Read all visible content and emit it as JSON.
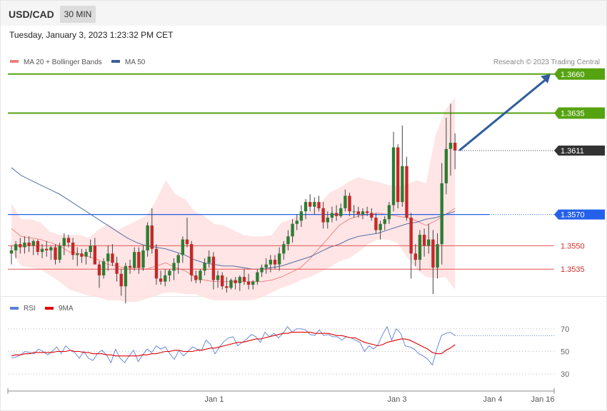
{
  "header": {
    "symbol": "USD/CAD",
    "timeframe": "30 MIN"
  },
  "datetime": "Tuesday, January 3, 2023 1:23:32 PM CET",
  "legend": {
    "ma20": "MA 20 + Bollinger Bands",
    "ma50": "MA 50",
    "credit": "Research © 2023 Trading Central",
    "rsi": "RSI",
    "rsi9": "9MA"
  },
  "colors": {
    "up": "#2e7d32",
    "down": "#c62828",
    "band": "#ffdcdc",
    "ma20": "#f08080",
    "ma50": "#3f5f9f",
    "resistance": "#56a311",
    "last": "#333333",
    "pivot": "#2461ea",
    "support": "#e05555",
    "arrow": "#2f5d9e",
    "rsi": "#5b7fd8",
    "rsi9": "#e00000"
  },
  "chart_data": [
    {
      "type": "candlestick",
      "ylim": [
        1.352,
        1.368
      ],
      "x_ticks": [
        "Jan 1",
        "Jan 3",
        "Jan 4",
        "Jan 16"
      ],
      "levels": [
        {
          "value": 1.366,
          "label": "1.3660",
          "kind": "resistance"
        },
        {
          "value": 1.3635,
          "label": "1.3635",
          "kind": "resistance"
        },
        {
          "value": 1.3611,
          "label": "1.3611",
          "kind": "last"
        },
        {
          "value": 1.357,
          "label": "1.3570",
          "kind": "pivot"
        },
        {
          "value": 1.355,
          "label": "1.3550",
          "kind": "support"
        },
        {
          "value": 1.3535,
          "label": "1.3535",
          "kind": "support"
        }
      ],
      "ohlc": [
        [
          1.3545,
          1.355,
          1.3538,
          1.3547
        ],
        [
          1.3547,
          1.3553,
          1.3542,
          1.3551
        ],
        [
          1.3551,
          1.3555,
          1.3545,
          1.3549
        ],
        [
          1.3549,
          1.3556,
          1.3545,
          1.3552
        ],
        [
          1.3552,
          1.3556,
          1.3546,
          1.355
        ],
        [
          1.355,
          1.3554,
          1.3544,
          1.3553
        ],
        [
          1.3553,
          1.3554,
          1.3544,
          1.3546
        ],
        [
          1.3546,
          1.3551,
          1.3542,
          1.3548
        ],
        [
          1.3548,
          1.3553,
          1.3543,
          1.3547
        ],
        [
          1.3547,
          1.355,
          1.3541,
          1.3549
        ],
        [
          1.3549,
          1.3551,
          1.3538,
          1.3541
        ],
        [
          1.3541,
          1.3552,
          1.3539,
          1.355
        ],
        [
          1.355,
          1.3558,
          1.3544,
          1.3555
        ],
        [
          1.3555,
          1.3557,
          1.3549,
          1.3552
        ],
        [
          1.3552,
          1.3555,
          1.3541,
          1.3544
        ],
        [
          1.3544,
          1.3549,
          1.3537,
          1.3545
        ],
        [
          1.3545,
          1.3548,
          1.3539,
          1.3543
        ],
        [
          1.3543,
          1.3548,
          1.3538,
          1.3546
        ],
        [
          1.3546,
          1.3554,
          1.3542,
          1.355
        ],
        [
          1.355,
          1.3555,
          1.354,
          1.3538
        ],
        [
          1.3538,
          1.354,
          1.3523,
          1.3531
        ],
        [
          1.3531,
          1.3542,
          1.3529,
          1.354
        ],
        [
          1.354,
          1.355,
          1.3534,
          1.3545
        ],
        [
          1.3545,
          1.3551,
          1.3537,
          1.3539
        ],
        [
          1.3539,
          1.3543,
          1.3527,
          1.3532
        ],
        [
          1.3532,
          1.3535,
          1.3518,
          1.3524
        ],
        [
          1.3524,
          1.3539,
          1.3513,
          1.3537
        ],
        [
          1.3537,
          1.3541,
          1.3532,
          1.3536
        ],
        [
          1.3536,
          1.3549,
          1.3534,
          1.3546
        ],
        [
          1.3546,
          1.3549,
          1.3532,
          1.3536
        ],
        [
          1.3536,
          1.355,
          1.3534,
          1.3547
        ],
        [
          1.3547,
          1.3565,
          1.3543,
          1.3563
        ],
        [
          1.3563,
          1.3574,
          1.3545,
          1.3548
        ],
        [
          1.3548,
          1.3551,
          1.3525,
          1.3529
        ],
        [
          1.3529,
          1.3534,
          1.3525,
          1.3527
        ],
        [
          1.3527,
          1.3535,
          1.3524,
          1.3531
        ],
        [
          1.3531,
          1.3535,
          1.3527,
          1.3534
        ],
        [
          1.3534,
          1.3542,
          1.3528,
          1.3539
        ],
        [
          1.3539,
          1.3545,
          1.3532,
          1.3544
        ],
        [
          1.3544,
          1.3556,
          1.3539,
          1.3554
        ],
        [
          1.3554,
          1.3568,
          1.3549,
          1.3551
        ],
        [
          1.3551,
          1.3553,
          1.3527,
          1.3531
        ],
        [
          1.3531,
          1.3534,
          1.3526,
          1.3528
        ],
        [
          1.3528,
          1.3535,
          1.3526,
          1.3534
        ],
        [
          1.3534,
          1.3542,
          1.3531,
          1.3539
        ],
        [
          1.3539,
          1.3547,
          1.3536,
          1.3543
        ],
        [
          1.3543,
          1.3546,
          1.3522,
          1.3528
        ],
        [
          1.3528,
          1.3534,
          1.3523,
          1.3531
        ],
        [
          1.3531,
          1.3533,
          1.3522,
          1.3524
        ],
        [
          1.3524,
          1.353,
          1.352,
          1.3523
        ],
        [
          1.3523,
          1.3529,
          1.3522,
          1.3528
        ],
        [
          1.3528,
          1.353,
          1.3522,
          1.3526
        ],
        [
          1.3526,
          1.3531,
          1.3521,
          1.353
        ],
        [
          1.353,
          1.3535,
          1.3525,
          1.3527
        ],
        [
          1.3527,
          1.3532,
          1.3522,
          1.3525
        ],
        [
          1.3525,
          1.3528,
          1.3522,
          1.3527
        ],
        [
          1.3527,
          1.3535,
          1.3525,
          1.3533
        ],
        [
          1.3533,
          1.3538,
          1.353,
          1.3536
        ],
        [
          1.3536,
          1.3542,
          1.3532,
          1.3538
        ],
        [
          1.3538,
          1.3544,
          1.3533,
          1.3541
        ],
        [
          1.3541,
          1.3544,
          1.3535,
          1.3538
        ],
        [
          1.3538,
          1.3549,
          1.3534,
          1.3545
        ],
        [
          1.3545,
          1.3553,
          1.3541,
          1.3551
        ],
        [
          1.3551,
          1.356,
          1.3547,
          1.3556
        ],
        [
          1.3556,
          1.3567,
          1.3552,
          1.3564
        ],
        [
          1.3564,
          1.357,
          1.356,
          1.3566
        ],
        [
          1.3566,
          1.3576,
          1.3562,
          1.3572
        ],
        [
          1.3572,
          1.358,
          1.3567,
          1.3578
        ],
        [
          1.3578,
          1.3583,
          1.3572,
          1.3575
        ],
        [
          1.3575,
          1.3581,
          1.357,
          1.3578
        ],
        [
          1.3578,
          1.3582,
          1.3572,
          1.3574
        ],
        [
          1.3574,
          1.3578,
          1.3561,
          1.3565
        ],
        [
          1.3565,
          1.3572,
          1.3561,
          1.3568
        ],
        [
          1.3568,
          1.3575,
          1.3565,
          1.3571
        ],
        [
          1.3571,
          1.3576,
          1.3566,
          1.3569
        ],
        [
          1.3569,
          1.3577,
          1.3568,
          1.3574
        ],
        [
          1.3574,
          1.3586,
          1.3572,
          1.3582
        ],
        [
          1.3582,
          1.3584,
          1.3569,
          1.3572
        ],
        [
          1.3572,
          1.3576,
          1.3568,
          1.3572
        ],
        [
          1.3572,
          1.3575,
          1.3568,
          1.357
        ],
        [
          1.357,
          1.3574,
          1.3567,
          1.3572
        ],
        [
          1.3572,
          1.3575,
          1.3569,
          1.3571
        ],
        [
          1.3571,
          1.3574,
          1.3566,
          1.3568
        ],
        [
          1.3568,
          1.3571,
          1.3558,
          1.356
        ],
        [
          1.356,
          1.3566,
          1.3554,
          1.3564
        ],
        [
          1.3564,
          1.3569,
          1.356,
          1.3567
        ],
        [
          1.3567,
          1.3578,
          1.3564,
          1.3576
        ],
        [
          1.3576,
          1.3623,
          1.3572,
          1.3613
        ],
        [
          1.3613,
          1.3615,
          1.3574,
          1.3578
        ],
        [
          1.3578,
          1.3627,
          1.3575,
          1.3601
        ],
        [
          1.3601,
          1.3607,
          1.3566,
          1.3568
        ],
        [
          1.3568,
          1.3571,
          1.3529,
          1.3545
        ],
        [
          1.3545,
          1.3551,
          1.3537,
          1.3541
        ],
        [
          1.3541,
          1.356,
          1.3534,
          1.3557
        ],
        [
          1.3557,
          1.3561,
          1.3543,
          1.355
        ],
        [
          1.355,
          1.3564,
          1.3545,
          1.3554
        ],
        [
          1.3554,
          1.356,
          1.3519,
          1.3536
        ],
        [
          1.3536,
          1.3558,
          1.3529,
          1.3551
        ],
        [
          1.3551,
          1.3603,
          1.3538,
          1.359
        ],
        [
          1.359,
          1.3632,
          1.3583,
          1.3612
        ],
        [
          1.3612,
          1.3641,
          1.3595,
          1.3616
        ],
        [
          1.3616,
          1.3622,
          1.3599,
          1.3611
        ]
      ],
      "bollinger": {
        "upper": [
          1.3577,
          1.3567,
          1.3567,
          1.3565,
          1.3559,
          1.3557,
          1.3557,
          1.3557,
          1.3555,
          1.356,
          1.3564,
          1.356,
          1.3563,
          1.3566,
          1.3569,
          1.3579,
          1.3592,
          1.3583,
          1.358,
          1.3572,
          1.3569,
          1.3564,
          1.3563,
          1.356,
          1.3557,
          1.3556,
          1.3556,
          1.3557,
          1.3565,
          1.3567,
          1.357,
          1.3572,
          1.3577,
          1.3584,
          1.3587,
          1.3591,
          1.3594,
          1.3592,
          1.3591,
          1.3589,
          1.3588,
          1.3589,
          1.3592,
          1.359,
          1.3621,
          1.3637,
          1.3645
        ],
        "lower": [
          1.3547,
          1.3537,
          1.3536,
          1.3535,
          1.3531,
          1.3527,
          1.3522,
          1.352,
          1.3518,
          1.3517,
          1.3515,
          1.3515,
          1.3514,
          1.3514,
          1.3516,
          1.3518,
          1.352,
          1.352,
          1.3519,
          1.3519,
          1.3517,
          1.3515,
          1.3515,
          1.3515,
          1.3515,
          1.3515,
          1.3517,
          1.352,
          1.3523,
          1.3525,
          1.3528,
          1.353,
          1.3533,
          1.3536,
          1.354,
          1.3542,
          1.3546,
          1.3551,
          1.3554,
          1.3554,
          1.3552,
          1.3543,
          1.3535,
          1.353,
          1.3529,
          1.353,
          1.3522
        ],
        "ma20": [
          1.3561,
          1.3556,
          1.3555,
          1.3554,
          1.3552,
          1.355,
          1.3546,
          1.3545,
          1.3543,
          1.3541,
          1.3538,
          1.3537,
          1.3535,
          1.3536,
          1.3535,
          1.3537,
          1.3539,
          1.3536,
          1.3534,
          1.353,
          1.3528,
          1.3527,
          1.3527,
          1.3527,
          1.3527,
          1.3527,
          1.3527,
          1.3528,
          1.353,
          1.3533,
          1.3536,
          1.3542,
          1.3549,
          1.3556,
          1.3563,
          1.3567,
          1.3569,
          1.357,
          1.3571,
          1.357,
          1.3569,
          1.3568,
          1.3566,
          1.3563,
          1.3566,
          1.357,
          1.3574
        ],
        "ma50": [
          1.36,
          1.3595,
          1.3592,
          1.3589,
          1.3586,
          1.3583,
          1.3579,
          1.3575,
          1.3571,
          1.3567,
          1.3563,
          1.3559,
          1.3555,
          1.3552,
          1.355,
          1.3549,
          1.3548,
          1.3546,
          1.3544,
          1.3541,
          1.3539,
          1.3538,
          1.3537,
          1.3537,
          1.3536,
          1.3535,
          1.3535,
          1.3536,
          1.3537,
          1.3539,
          1.3541,
          1.3543,
          1.3546,
          1.3549,
          1.3551,
          1.3554,
          1.3556,
          1.3557,
          1.3558,
          1.356,
          1.3562,
          1.3564,
          1.3565,
          1.3567,
          1.3568,
          1.357,
          1.3572
        ]
      }
    },
    {
      "type": "line",
      "ylim": [
        20,
        80
      ],
      "y_ticks": [
        70,
        50,
        30
      ],
      "series": [
        {
          "name": "RSI",
          "values": [
            44,
            45,
            47,
            50,
            49,
            48,
            52,
            50,
            47,
            50,
            54,
            48,
            55,
            51,
            49,
            44,
            50,
            44,
            42,
            48,
            51,
            47,
            40,
            52,
            44,
            40,
            46,
            51,
            41,
            47,
            52,
            49,
            55,
            52,
            54,
            48,
            43,
            51,
            46,
            50,
            54,
            52,
            51,
            60,
            56,
            48,
            54,
            59,
            62,
            63,
            55,
            58,
            61,
            65,
            63,
            58,
            67,
            63,
            66,
            62,
            66,
            72,
            67,
            70,
            70,
            69,
            65,
            64,
            69,
            64,
            65,
            63,
            63,
            60,
            63,
            62,
            60,
            58,
            50,
            55,
            52,
            56,
            65,
            72,
            60,
            70,
            66,
            55,
            54,
            52,
            48,
            46,
            43,
            38,
            52,
            64,
            66,
            67,
            64
          ]
        },
        {
          "name": "9MA",
          "values": [
            46,
            47,
            47,
            48,
            48,
            49,
            49,
            49,
            49,
            49,
            50,
            50,
            50,
            51,
            50,
            50,
            49,
            49,
            48,
            48,
            48,
            47,
            47,
            46,
            46,
            46,
            46,
            46,
            46,
            47,
            47,
            48,
            48,
            49,
            50,
            50,
            51,
            51,
            50,
            50,
            50,
            51,
            51,
            52,
            53,
            53,
            54,
            55,
            56,
            57,
            58,
            58,
            59,
            60,
            61,
            61,
            62,
            63,
            64,
            65,
            66,
            66,
            67,
            67,
            67,
            67,
            67,
            66,
            66,
            66,
            66,
            65,
            64,
            64,
            63,
            62,
            62,
            60,
            58,
            57,
            56,
            55,
            56,
            58,
            59,
            60,
            61,
            61,
            60,
            58,
            56,
            54,
            52,
            49,
            48,
            48,
            51,
            53,
            56
          ]
        }
      ]
    }
  ]
}
